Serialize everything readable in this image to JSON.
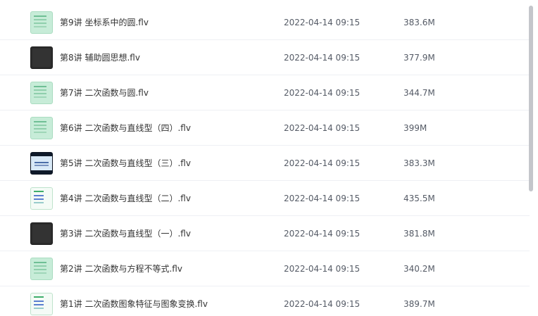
{
  "files": [
    {
      "name": "第9讲 坐标系中的圆.flv",
      "date": "2022-04-14 09:15",
      "size": "383.6M",
      "thumbnail": "green"
    },
    {
      "name": "第8讲 辅助圆思想.flv",
      "date": "2022-04-14 09:15",
      "size": "377.9M",
      "thumbnail": "dark"
    },
    {
      "name": "第7讲 二次函数与圆.flv",
      "date": "2022-04-14 09:15",
      "size": "344.7M",
      "thumbnail": "green"
    },
    {
      "name": "第6讲 二次函数与直线型（四）.flv",
      "date": "2022-04-14 09:15",
      "size": "399M",
      "thumbnail": "green"
    },
    {
      "name": "第5讲 二次函数与直线型（三）.flv",
      "date": "2022-04-14 09:15",
      "size": "383.3M",
      "thumbnail": "video"
    },
    {
      "name": "第4讲 二次函数与直线型（二）.flv",
      "date": "2022-04-14 09:15",
      "size": "435.5M",
      "thumbnail": "white"
    },
    {
      "name": "第3讲 二次函数与直线型（一）.flv",
      "date": "2022-04-14 09:15",
      "size": "381.8M",
      "thumbnail": "dark"
    },
    {
      "name": "第2讲 二次函数与方程不等式.flv",
      "date": "2022-04-14 09:15",
      "size": "340.2M",
      "thumbnail": "green"
    },
    {
      "name": "第1讲 二次函数图象特征与图象变换.flv",
      "date": "2022-04-14 09:15",
      "size": "389.7M",
      "thumbnail": "white"
    }
  ],
  "colors": {
    "divider": "#eef0f4",
    "text_primary": "#333333",
    "text_secondary": "#555b66",
    "scrollbar": "#c4c6cb"
  }
}
